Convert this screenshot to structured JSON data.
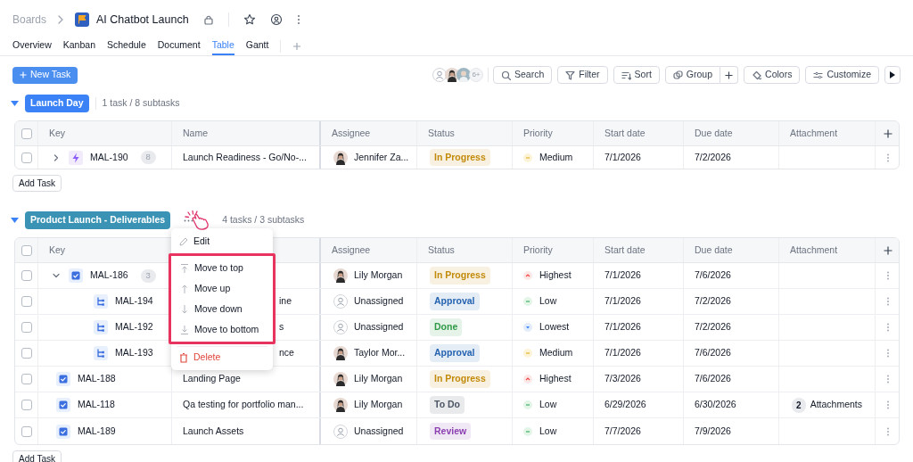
{
  "breadcrumb": {
    "root": "Boards",
    "title": "AI Chatbot Launch"
  },
  "tabs": [
    {
      "label": "Overview",
      "selected": false
    },
    {
      "label": "Kanban",
      "selected": false
    },
    {
      "label": "Schedule",
      "selected": false
    },
    {
      "label": "Document",
      "selected": false
    },
    {
      "label": "Table",
      "selected": true
    },
    {
      "label": "Gantt",
      "selected": false
    }
  ],
  "toolbar": {
    "new_task": "New Task",
    "member_count": "6+",
    "buttons": [
      {
        "kind": "search",
        "label": "Search"
      },
      {
        "kind": "filter",
        "label": "Filter"
      },
      {
        "kind": "sort",
        "label": "Sort"
      },
      {
        "kind": "group",
        "label": "Group"
      },
      {
        "kind": "colors",
        "label": "Colors"
      },
      {
        "kind": "customize",
        "label": "Customize"
      }
    ]
  },
  "groups": [
    {
      "label": "Launch Day",
      "color": "#3b82f6",
      "summary": "1 task / 8 subtasks",
      "expanded": true,
      "add_task": "Add Task",
      "all_checked": false,
      "columns": [
        "Key",
        "Name",
        "Assignee",
        "Status",
        "Priority",
        "Start date",
        "Due date",
        "Attachment"
      ],
      "rows": [
        {
          "kind": "epic",
          "checked": false,
          "key": "MAL-190",
          "count": "8",
          "expanded": false,
          "name": "Launch Readiness - Go/No-...",
          "assignee": {
            "kind": "person",
            "name": "Jennifer Za..."
          },
          "status": {
            "text": "In Progress",
            "color": "#c28a0a"
          },
          "priority": {
            "kind": "medium",
            "text": "Medium"
          },
          "start": "7/1/2026",
          "due": "7/2/2026"
        }
      ]
    },
    {
      "label": "Product Launch - Deliverables",
      "color": "#3a93b5",
      "summary": "4 tasks / 3 subtasks",
      "expanded": true,
      "add_task": "Add Task",
      "all_checked": false,
      "columns": [
        "Key",
        null,
        "Assignee",
        "Status",
        "Priority",
        "Start date",
        "Due date",
        "Attachment"
      ],
      "rows": [
        {
          "kind": "task",
          "checked": false,
          "key": "MAL-186",
          "count": "3",
          "expanded": true,
          "assignee": {
            "kind": "person",
            "name": "Lily Morgan"
          },
          "status": {
            "text": "In Progress",
            "color": "#c28a0a"
          },
          "priority": {
            "kind": "highest",
            "text": "Highest"
          },
          "start": "7/1/2026",
          "due": "7/6/2026",
          "children": [
            {
              "kind": "subtask",
              "checked": false,
              "key": "MAL-194",
              "name": "ine",
              "name_covered": true,
              "assignee": {
                "kind": "unassigned",
                "name": "Unassigned"
              },
              "status": {
                "text": "Approval",
                "color": "#2563b0"
              },
              "priority": {
                "kind": "low",
                "text": "Low"
              },
              "start": "7/1/2026",
              "due": "7/2/2026"
            },
            {
              "kind": "subtask",
              "checked": false,
              "key": "MAL-192",
              "name": "s",
              "name_covered": true,
              "assignee": {
                "kind": "unassigned",
                "name": "Unassigned"
              },
              "status": {
                "text": "Done",
                "color": "#2f9a46"
              },
              "priority": {
                "kind": "lowest",
                "text": "Lowest"
              },
              "start": "7/1/2026",
              "due": "7/2/2026"
            },
            {
              "kind": "subtask",
              "checked": false,
              "key": "MAL-193",
              "name": "nce",
              "name_covered": true,
              "assignee": {
                "kind": "person",
                "name": "Taylor Mor..."
              },
              "status": {
                "text": "Approval",
                "color": "#2563b0"
              },
              "priority": {
                "kind": "medium",
                "text": "Medium"
              },
              "start": "7/1/2026",
              "due": "7/6/2026"
            }
          ]
        },
        {
          "kind": "task",
          "checked": false,
          "key": "MAL-188",
          "name": "Landing Page",
          "assignee": {
            "kind": "person",
            "name": "Lily Morgan"
          },
          "status": {
            "text": "In Progress",
            "color": "#c28a0a"
          },
          "priority": {
            "kind": "highest",
            "text": "Highest"
          },
          "start": "7/3/2026",
          "due": "7/6/2026"
        },
        {
          "kind": "task",
          "checked": false,
          "key": "MAL-118",
          "name": "Qa testing for portfolio man...",
          "assignee": {
            "kind": "person",
            "name": "Lily Morgan"
          },
          "status": {
            "text": "To Do",
            "color": "#4b5563"
          },
          "priority": {
            "kind": "low",
            "text": "Low"
          },
          "start": "6/29/2026",
          "due": "6/30/2026",
          "attachments": {
            "count": "2",
            "label": "Attachments"
          }
        },
        {
          "kind": "task",
          "checked": false,
          "key": "MAL-189",
          "name": "Launch Assets",
          "assignee": {
            "kind": "unassigned",
            "name": "Unassigned"
          },
          "status": {
            "text": "Review",
            "color": "#8b3fb0"
          },
          "priority": {
            "kind": "low",
            "text": "Low"
          },
          "start": "7/7/2026",
          "due": "7/9/2026"
        }
      ]
    }
  ],
  "context_menu": {
    "items": [
      {
        "kind": "edit",
        "label": "Edit"
      },
      {
        "kind": "top",
        "label": "Move to top",
        "highlighted": true
      },
      {
        "kind": "up",
        "label": "Move up",
        "highlighted": true
      },
      {
        "kind": "down",
        "label": "Move down",
        "highlighted": true
      },
      {
        "kind": "bottom",
        "label": "Move to bottom",
        "highlighted": true
      },
      {
        "kind": "delete",
        "label": "Delete"
      }
    ]
  }
}
